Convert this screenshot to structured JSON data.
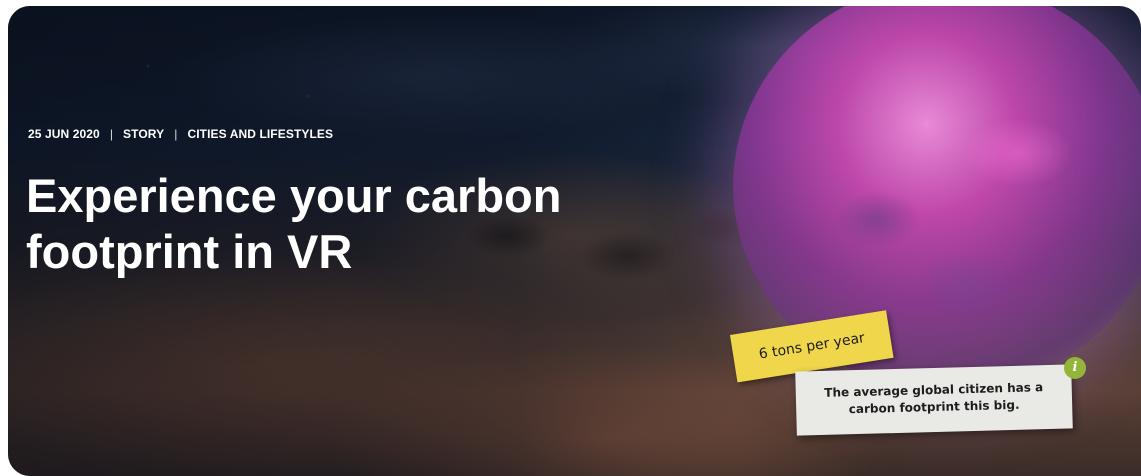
{
  "article": {
    "date": "25 JUN 2020",
    "type": "STORY",
    "category": "CITIES AND LIFESTYLES",
    "title_line1": "Experience your carbon",
    "title_line2": "footprint in VR"
  },
  "image": {
    "yellow_note": "6 tons per year",
    "white_note_line1": "The average global citizen has a",
    "white_note_line2": "carbon footprint this big.",
    "info_icon": "info-icon"
  },
  "colors": {
    "note_yellow": "#f0d64a",
    "info_green": "#93b53a",
    "sphere_pink": "#e050c8"
  }
}
